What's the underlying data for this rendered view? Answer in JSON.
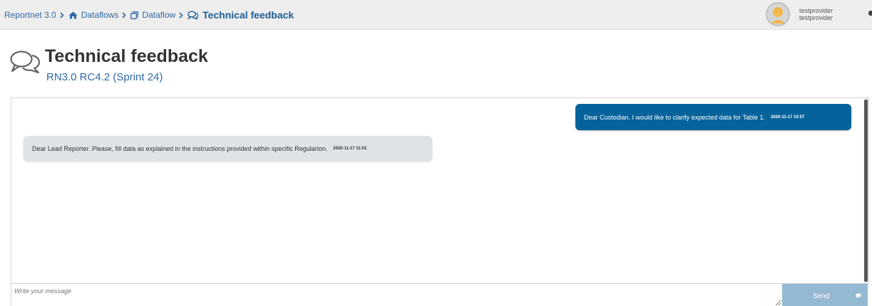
{
  "breadcrumb": {
    "items": [
      {
        "label": "Reportnet 3.0",
        "icon": null
      },
      {
        "label": "Dataflows",
        "icon": "home-icon"
      },
      {
        "label": "Dataflow",
        "icon": "clone-icon"
      },
      {
        "label": "Technical feedback",
        "icon": "comments-icon"
      }
    ]
  },
  "user": {
    "name": "testprovider",
    "role": "testprovider"
  },
  "page": {
    "title": "Technical feedback",
    "subtitle": "RN3.0 RC4.2 (Sprint 24)",
    "icon": "comments-icon"
  },
  "messages": [
    {
      "direction": "sent",
      "text": "Dear Custodian. I would like to clarify expected data for Table 1.",
      "timestamp": "2020-11-17 10:57"
    },
    {
      "direction": "received",
      "text": "Dear Lead Reporter. Please, fill data as explained in the instructions provided within specific Regularion.",
      "timestamp": "2020-11-17 11:01"
    }
  ],
  "composer": {
    "placeholder": "Write your message",
    "value": "",
    "send_label": "Send",
    "send_icon": "comment-icon"
  },
  "colors": {
    "link": "#2f6aa5",
    "sent_bubble": "#06629b",
    "received_bubble": "#dfe3e8",
    "send_button": "#94b9d3",
    "topbar": "#eeeeee"
  }
}
